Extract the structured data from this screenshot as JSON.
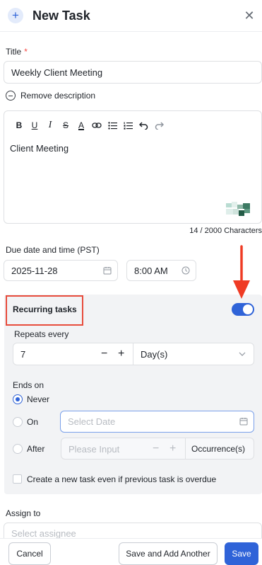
{
  "header": {
    "title": "New Task",
    "plus_glyph": "+",
    "close_glyph": "✕"
  },
  "title_field": {
    "label": "Title",
    "required_mark": "*",
    "value": "Weekly Client Meeting"
  },
  "description": {
    "remove_label": "Remove description",
    "toolbar": [
      "B",
      "U",
      "I",
      "S",
      "A"
    ],
    "content": "Client Meeting",
    "char_count": "14 / 2000 Characters"
  },
  "due": {
    "label": "Due date and time (PST)",
    "date": "2025-11-28",
    "time": "8:00 AM"
  },
  "recurring": {
    "title": "Recurring tasks",
    "enabled": true,
    "repeats_label": "Repeats every",
    "repeat_value": "7",
    "minus": "−",
    "plus": "+",
    "unit": "Day(s)",
    "ends_label": "Ends on",
    "never_label": "Never",
    "on_label": "On",
    "on_placeholder": "Select Date",
    "after_label": "After",
    "after_placeholder": "Please Input",
    "occurrence_label": "Occurrence(s)",
    "overdue_label": "Create a new task even if previous task is overdue"
  },
  "assign": {
    "label": "Assign to",
    "placeholder": "Select assignee"
  },
  "footer": {
    "cancel": "Cancel",
    "save_add": "Save and Add Another",
    "save": "Save"
  },
  "colors": {
    "primary": "#2f63d8",
    "highlight": "#e74c3c",
    "arrow": "#ef3b24"
  }
}
